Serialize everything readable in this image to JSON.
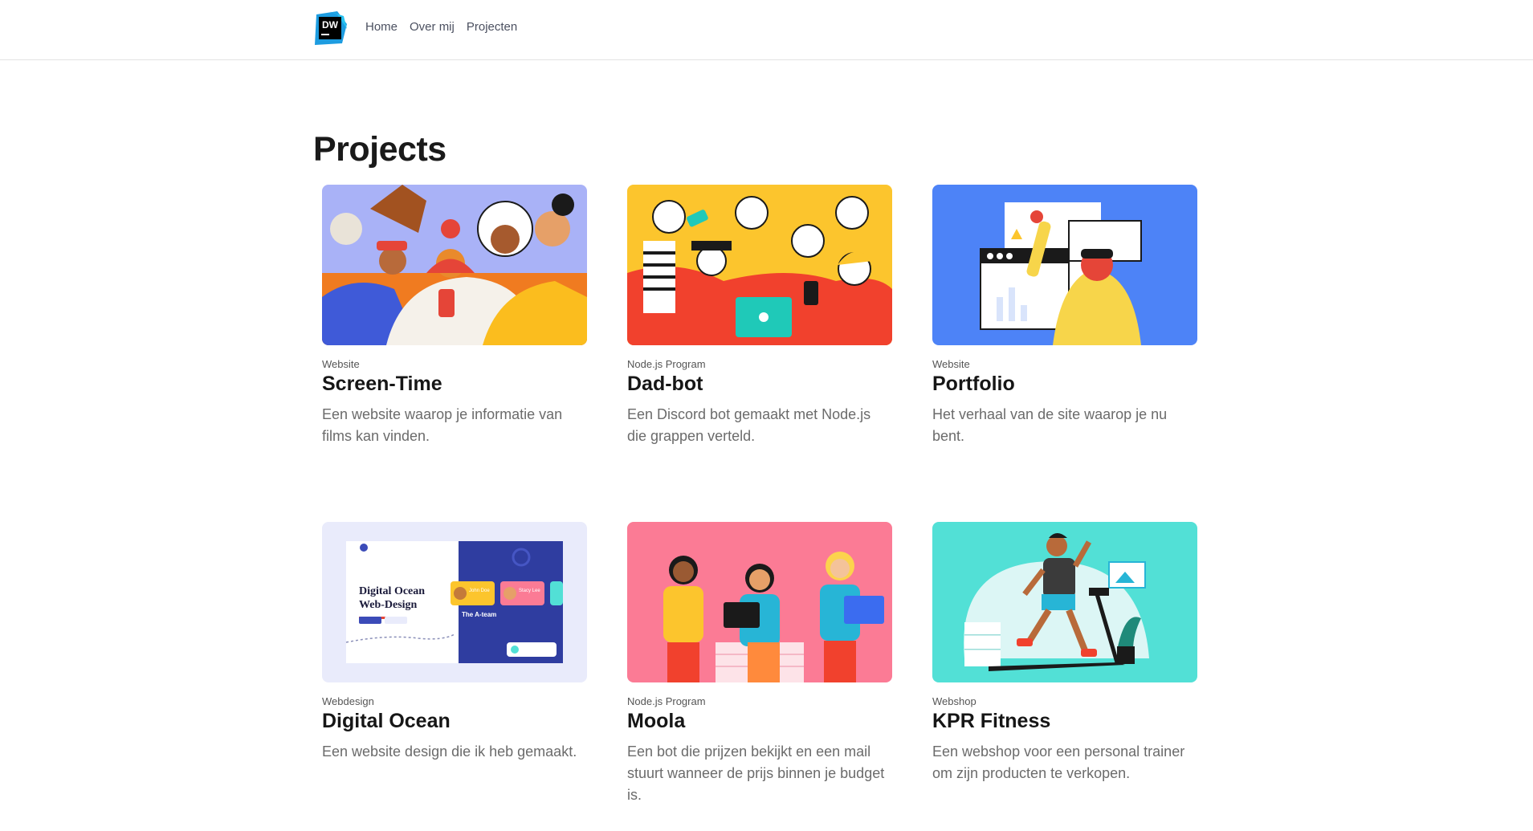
{
  "nav": {
    "logo_text": "DW",
    "links": [
      "Home",
      "Over mij",
      "Projecten"
    ]
  },
  "page": {
    "title": "Projects"
  },
  "projects": [
    {
      "category": "Website",
      "title": "Screen-Time",
      "description": "Een website waarop je informatie van films kan vinden."
    },
    {
      "category": "Node.js Program",
      "title": "Dad-bot",
      "description": "Een Discord bot gemaakt met Node.js die grappen verteld."
    },
    {
      "category": "Website",
      "title": "Portfolio",
      "description": "Het verhaal van de site waarop je nu bent."
    },
    {
      "category": "Webdesign",
      "title": "Digital Ocean",
      "description": "Een website design die ik heb gemaakt.",
      "thumb_text": {
        "heading_line1": "Digital Ocean",
        "heading_line2": "Web-Design",
        "team": "The A-team",
        "person1": "John Doe",
        "person2": "Stacy Lee"
      }
    },
    {
      "category": "Node.js Program",
      "title": "Moola",
      "description": "Een bot die prijzen bekijkt en een mail stuurt wanneer de prijs binnen je budget is."
    },
    {
      "category": "Webshop",
      "title": "KPR Fitness",
      "description": "Een webshop voor een personal trainer om zijn producten te verkopen."
    }
  ],
  "colors": {
    "thumb_bg": [
      "#a9b2f7",
      "#fcc52d",
      "#4d83f7",
      "#e9ebfb",
      "#fb7b95",
      "#52e0d6"
    ]
  }
}
